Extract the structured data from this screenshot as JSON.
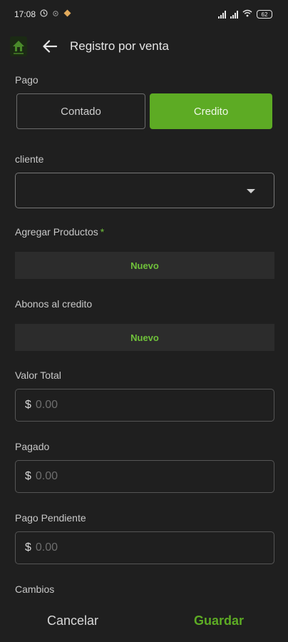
{
  "status_bar": {
    "time": "17:08",
    "battery": "62",
    "icons": [
      "clock-icon",
      "settings-icon",
      "diamond-icon",
      "signal-icon",
      "signal-icon",
      "wifi-icon",
      "battery-icon"
    ]
  },
  "app_bar": {
    "title": "Registro por venta",
    "back_icon": "arrow-left-icon",
    "logo_icon": "app-logo-icon"
  },
  "form": {
    "payment": {
      "label": "Pago",
      "options": [
        "Contado",
        "Credito"
      ],
      "selected": "Credito"
    },
    "client": {
      "label": "cliente",
      "value": "",
      "icon": "dropdown-caret-icon"
    },
    "products": {
      "label": "Agregar Productos",
      "required_mark": "*",
      "button": "Nuevo"
    },
    "credit_payments": {
      "label": "Abonos al credito",
      "button": "Nuevo"
    },
    "total_value": {
      "label": "Valor Total",
      "currency": "$",
      "placeholder": "0.00"
    },
    "paid": {
      "label": "Pagado",
      "currency": "$",
      "placeholder": "0.00"
    },
    "pending": {
      "label": "Pago Pendiente",
      "currency": "$",
      "placeholder": "0.00"
    },
    "changes": {
      "label": "Cambios"
    }
  },
  "footer": {
    "cancel": "Cancelar",
    "save": "Guardar"
  },
  "colors": {
    "background": "#1f1f1f",
    "accent": "#5dab24",
    "field_fill": "#2c2c2c"
  }
}
